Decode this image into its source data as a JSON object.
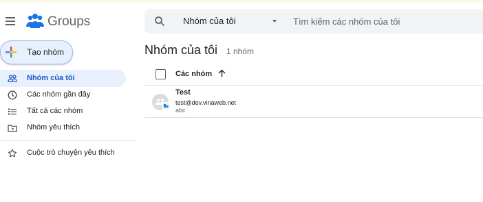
{
  "app": {
    "brand": "Groups"
  },
  "search": {
    "scope": "Nhóm của tôi",
    "placeholder": "Tìm kiếm các nhóm của tôi",
    "value": ""
  },
  "create_button": {
    "label": "Tạo nhóm"
  },
  "sidebar": {
    "items": [
      {
        "label": "Nhóm của tôi",
        "icon": "people-icon",
        "active": true
      },
      {
        "label": "Các nhóm gần đây",
        "icon": "clock-icon",
        "active": false
      },
      {
        "label": "Tất cả các nhóm",
        "icon": "list-icon",
        "active": false
      },
      {
        "label": "Nhóm yêu thích",
        "icon": "folder-star-icon",
        "active": false
      },
      {
        "label": "Cuộc trò chuyện yêu thích",
        "icon": "star-icon",
        "active": false
      }
    ]
  },
  "main": {
    "title": "Nhóm của tôi",
    "count": "1 nhóm",
    "column_header": "Các nhóm",
    "groups": [
      {
        "name": "Test",
        "email": "test@dev.vinaweb.net",
        "description": "abc"
      }
    ]
  },
  "colors": {
    "accent": "#1a56c4",
    "active_bg": "#e8f0fe",
    "search_bg": "#f1f3f4",
    "logo": "#1a73e8"
  }
}
